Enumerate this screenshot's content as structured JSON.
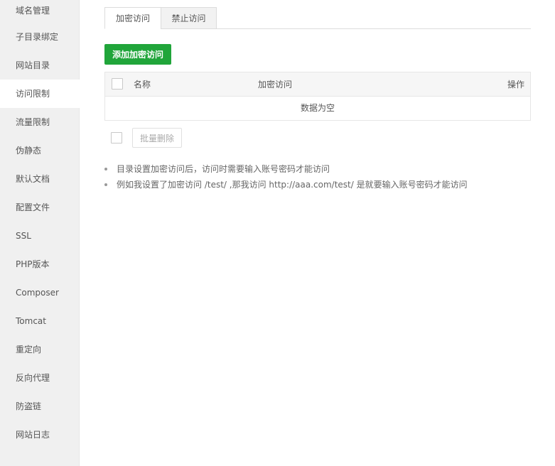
{
  "sidebar": {
    "items": [
      {
        "label": "域名管理"
      },
      {
        "label": "子目录绑定"
      },
      {
        "label": "网站目录"
      },
      {
        "label": "访问限制"
      },
      {
        "label": "流量限制"
      },
      {
        "label": "伪静态"
      },
      {
        "label": "默认文档"
      },
      {
        "label": "配置文件"
      },
      {
        "label": "SSL"
      },
      {
        "label": "PHP版本"
      },
      {
        "label": "Composer"
      },
      {
        "label": "Tomcat"
      },
      {
        "label": "重定向"
      },
      {
        "label": "反向代理"
      },
      {
        "label": "防盗链"
      },
      {
        "label": "网站日志"
      }
    ],
    "active": "访问限制"
  },
  "tabs": [
    {
      "label": "加密访问",
      "active": true
    },
    {
      "label": "禁止访问",
      "active": false
    }
  ],
  "toolbar": {
    "add_label": "添加加密访问"
  },
  "table": {
    "columns": [
      "名称",
      "加密访问",
      "操作"
    ],
    "rows": [],
    "empty_text": "数据为空"
  },
  "batch": {
    "delete_label": "批量删除"
  },
  "tips": [
    "目录设置加密访问后，访问时需要输入账号密码才能访问",
    "例如我设置了加密访问 /test/ ,那我访问 http://aaa.com/test/ 是就要输入账号密码才能访问"
  ],
  "colors": {
    "accent": "#20a53a",
    "sidebar_bg": "#f0f0f0"
  }
}
